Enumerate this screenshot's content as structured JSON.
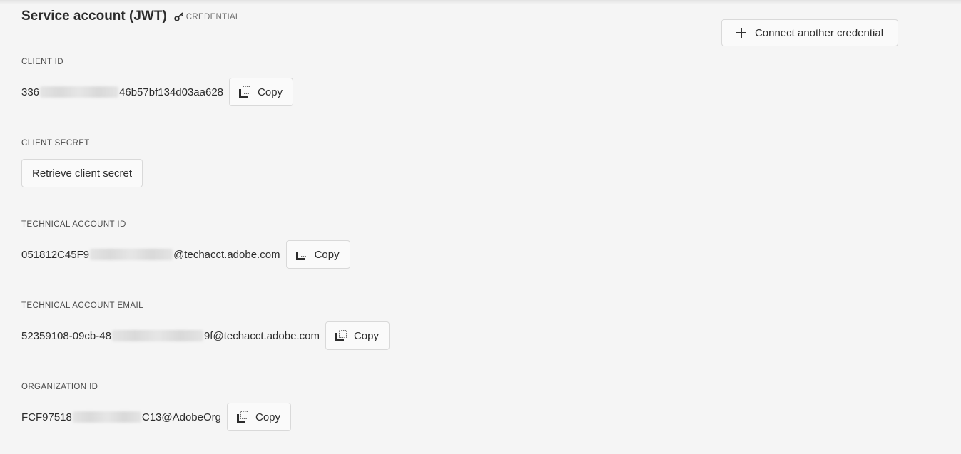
{
  "header": {
    "title": "Service account (JWT)",
    "credential_label": "CREDENTIAL"
  },
  "actions": {
    "connect_label": "Connect another credential"
  },
  "fields": {
    "client_id": {
      "label": "CLIENT ID",
      "prefix": "336",
      "suffix": "46b57bf134d03aa628",
      "copy_label": "Copy"
    },
    "client_secret": {
      "label": "CLIENT SECRET",
      "button_label": "Retrieve client secret"
    },
    "technical_account_id": {
      "label": "TECHNICAL ACCOUNT ID",
      "prefix": "051812C45F9",
      "suffix": "@techacct.adobe.com",
      "copy_label": "Copy"
    },
    "technical_account_email": {
      "label": "TECHNICAL ACCOUNT EMAIL",
      "prefix": "52359108-09cb-48",
      "suffix": "9f@techacct.adobe.com",
      "copy_label": "Copy"
    },
    "organization_id": {
      "label": "ORGANIZATION ID",
      "prefix": "FCF97518",
      "suffix": "C13@AdobeOrg",
      "copy_label": "Copy"
    }
  },
  "icons": {
    "credential": "key-icon",
    "connect": "plus-icon",
    "copy": "copy-icon"
  },
  "colors": {
    "background": "#f5f5f5",
    "button_border": "#d9d9d9",
    "text": "#2c2c2c"
  }
}
